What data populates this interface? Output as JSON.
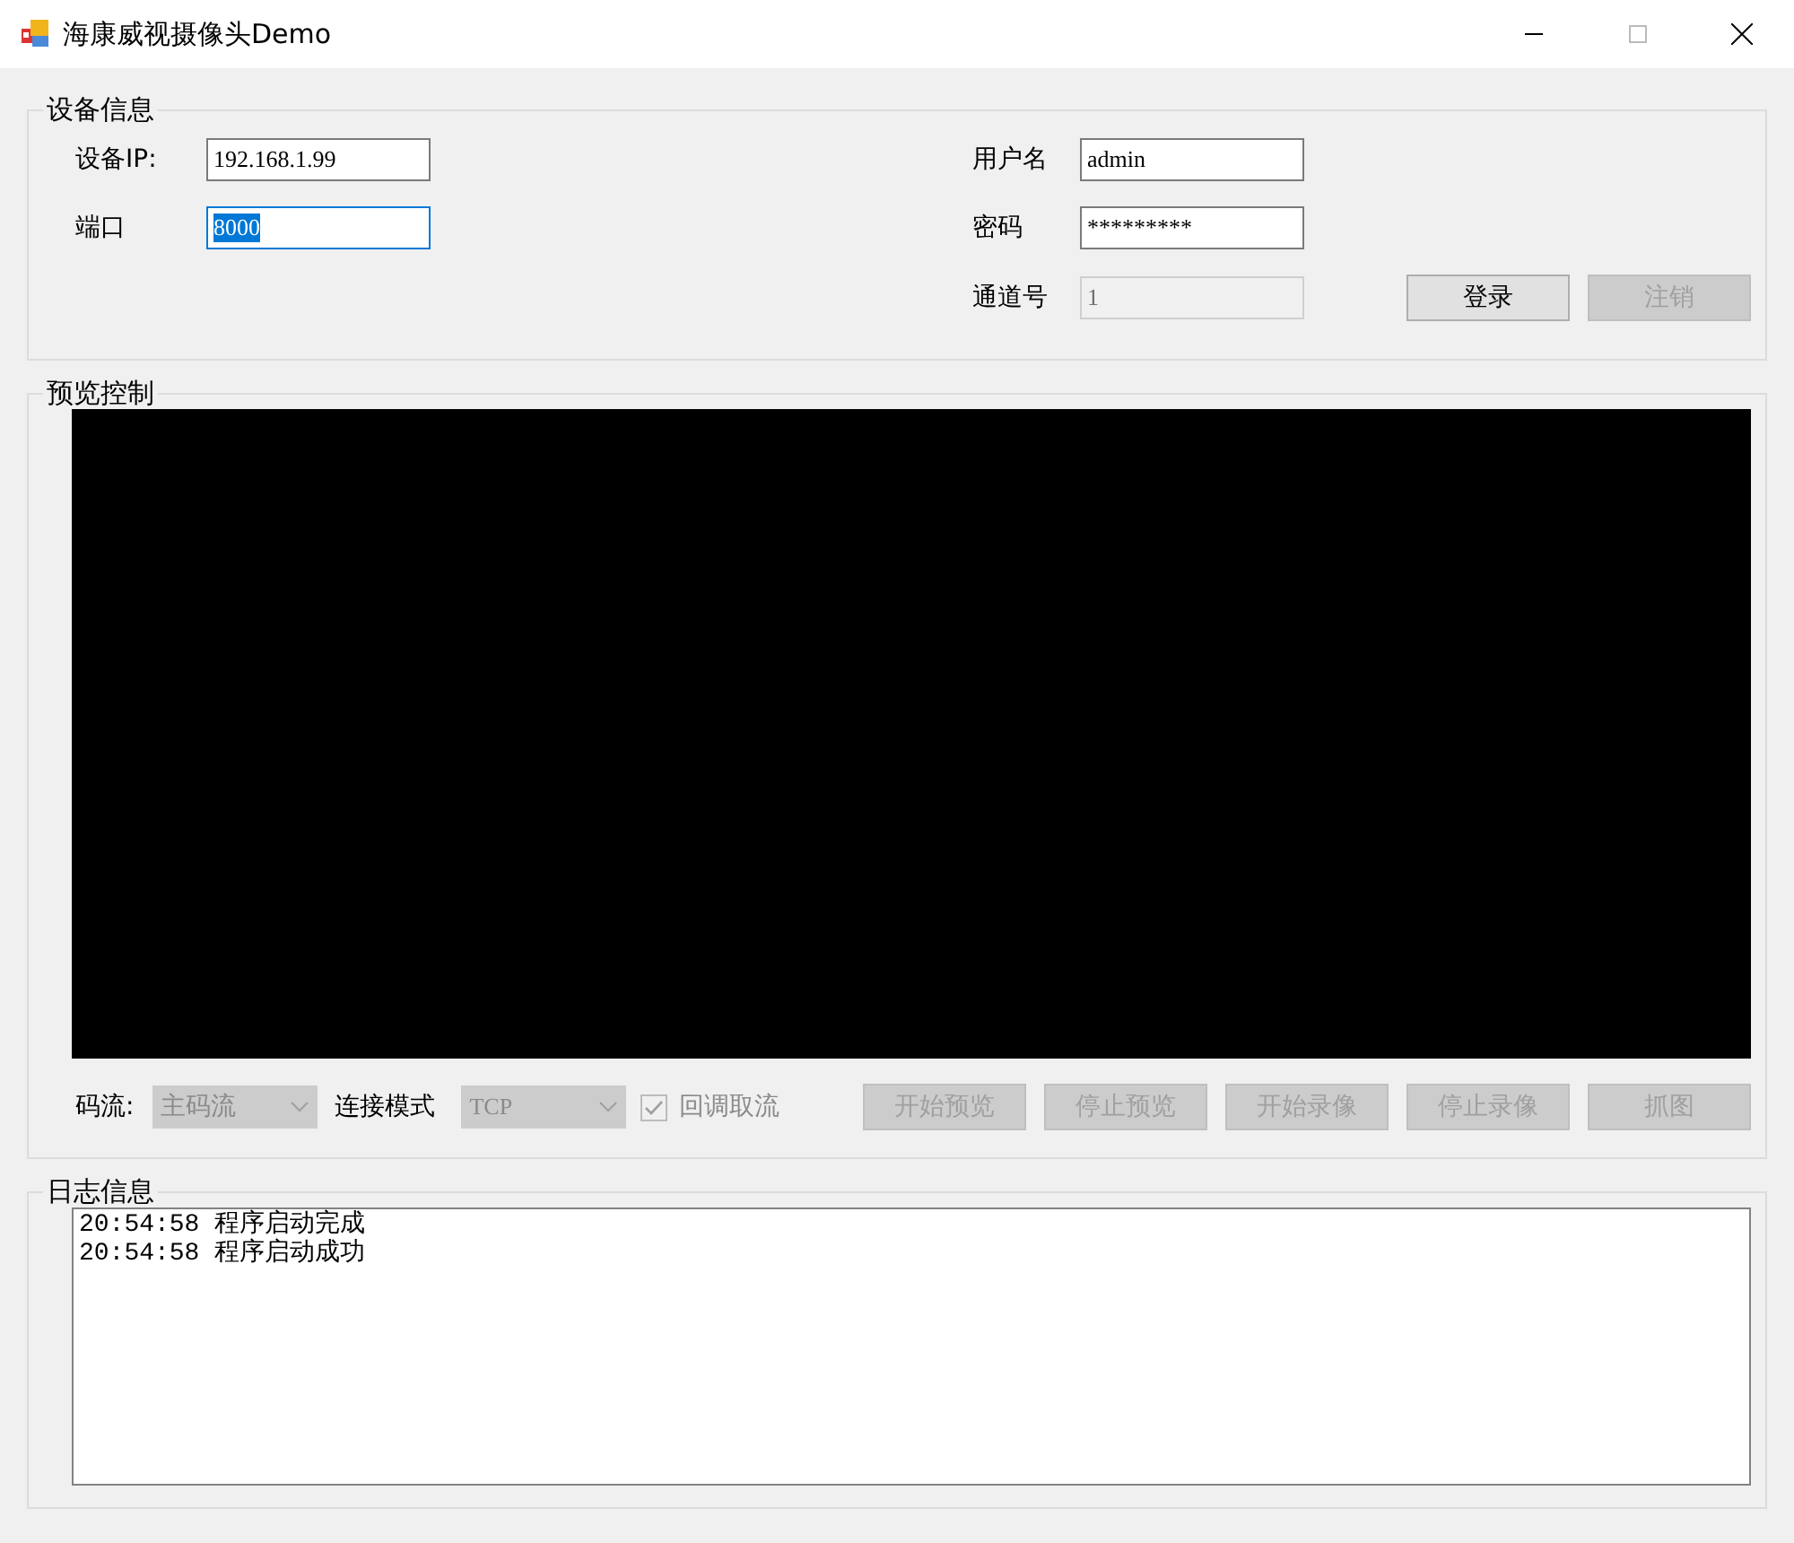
{
  "window": {
    "title": "海康威视摄像头Demo"
  },
  "device_info": {
    "title": "设备信息",
    "left_fields": [
      {
        "label": "设备IP:",
        "value": "192.168.1.99",
        "focused": false,
        "disabled": false
      },
      {
        "label": "端口",
        "value": "8000",
        "focused": true,
        "disabled": false
      }
    ],
    "right_fields": [
      {
        "label": "用户名",
        "value": "admin",
        "focused": false,
        "disabled": false
      },
      {
        "label": "密码",
        "value": "*********",
        "focused": false,
        "disabled": false
      },
      {
        "label": "通道号",
        "value": "1",
        "focused": false,
        "disabled": true
      }
    ],
    "buttons": [
      {
        "label": "登录",
        "disabled": false
      },
      {
        "label": "注销",
        "disabled": true
      }
    ]
  },
  "preview": {
    "title": "预览控制",
    "stream": {
      "label": "码流:",
      "value": "主码流",
      "disabled": true
    },
    "connection_mode": {
      "label": "连接模式",
      "value": "TCP",
      "disabled": true
    },
    "callback": {
      "label": "回调取流",
      "checked": true,
      "disabled": true
    },
    "buttons": [
      {
        "label": "开始预览",
        "disabled": true
      },
      {
        "label": "停止预览",
        "disabled": true
      },
      {
        "label": "开始录像",
        "disabled": true
      },
      {
        "label": "停止录像",
        "disabled": true
      },
      {
        "label": "抓图",
        "disabled": true
      }
    ]
  },
  "log": {
    "title": "日志信息",
    "lines": [
      "20:54:58 程序启动完成",
      "20:54:58 程序启动成功"
    ]
  }
}
